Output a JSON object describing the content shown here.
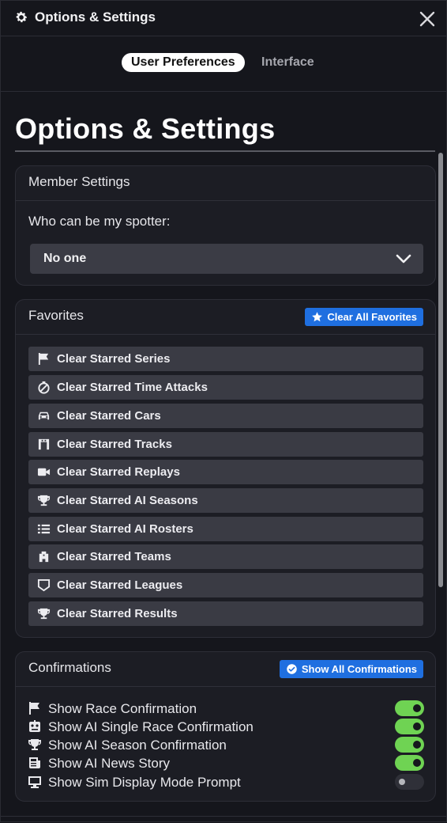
{
  "window": {
    "title": "Options & Settings",
    "close_icon": "close-icon"
  },
  "tabs": [
    {
      "label": "User Preferences",
      "active": true
    },
    {
      "label": "Interface",
      "active": false
    }
  ],
  "page": {
    "title": "Options & Settings"
  },
  "member_settings": {
    "title": "Member Settings",
    "spotter_label": "Who can be my spotter:",
    "spotter_value": "No one"
  },
  "favorites": {
    "title": "Favorites",
    "clear_all_label": "Clear All Favorites",
    "items": [
      {
        "label": "Clear Starred Series",
        "icon": "flag-icon"
      },
      {
        "label": "Clear Starred Time Attacks",
        "icon": "stopwatch-icon"
      },
      {
        "label": "Clear Starred Cars",
        "icon": "car-icon"
      },
      {
        "label": "Clear Starred Tracks",
        "icon": "track-icon"
      },
      {
        "label": "Clear Starred Replays",
        "icon": "video-camera-icon"
      },
      {
        "label": "Clear Starred AI Seasons",
        "icon": "trophy-icon"
      },
      {
        "label": "Clear Starred AI Rosters",
        "icon": "list-icon"
      },
      {
        "label": "Clear Starred Teams",
        "icon": "team-icon"
      },
      {
        "label": "Clear Starred Leagues",
        "icon": "shield-icon"
      },
      {
        "label": "Clear Starred Results",
        "icon": "trophy-icon"
      }
    ]
  },
  "confirmations": {
    "title": "Confirmations",
    "show_all_label": "Show All Confirmations",
    "items": [
      {
        "label": "Show Race Confirmation",
        "icon": "flag-icon",
        "enabled": true
      },
      {
        "label": "Show AI Single Race Confirmation",
        "icon": "robot-icon",
        "enabled": true
      },
      {
        "label": "Show AI Season Confirmation",
        "icon": "trophy-icon",
        "enabled": true
      },
      {
        "label": "Show AI News Story",
        "icon": "newspaper-icon",
        "enabled": true
      },
      {
        "label": "Show Sim Display Mode Prompt",
        "icon": "monitor-icon",
        "enabled": false
      }
    ]
  },
  "colors": {
    "accent": "#1f6fe0",
    "toggle_on": "#6fd353"
  }
}
